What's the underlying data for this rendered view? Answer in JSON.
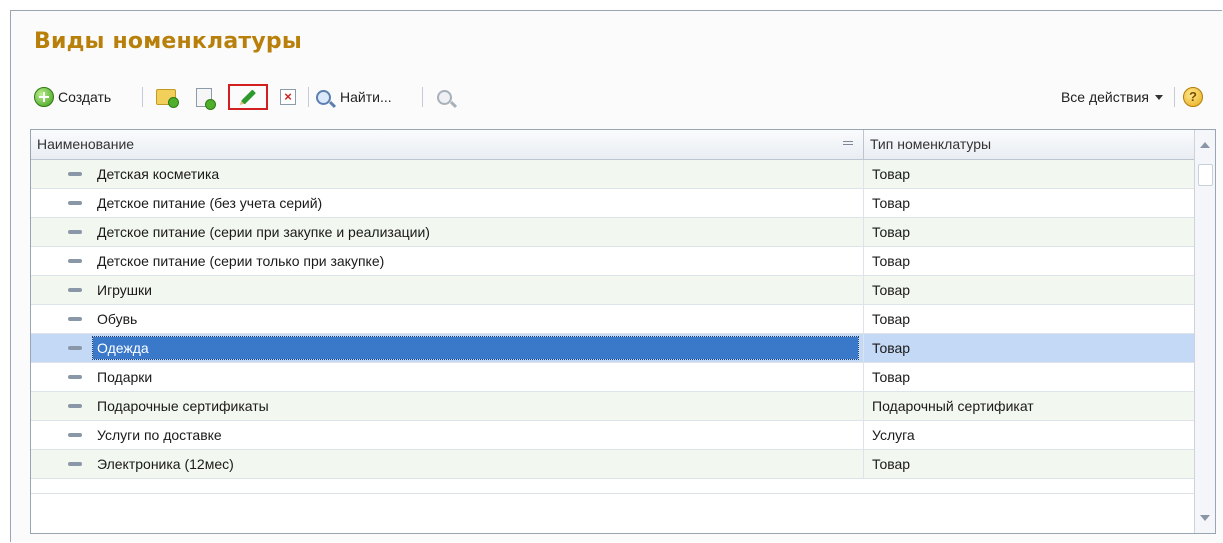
{
  "form": {
    "title": "Виды номенклатуры"
  },
  "toolbar": {
    "create_label": "Создать",
    "find_label": "Найти...",
    "all_actions_label": "Все действия",
    "help_label": "?"
  },
  "table": {
    "columns": [
      "Наименование",
      "Тип номенклатуры"
    ],
    "rows": [
      {
        "name": "Детская косметика",
        "type": "Товар"
      },
      {
        "name": "Детское питание (без учета серий)",
        "type": "Товар"
      },
      {
        "name": "Детское питание (серии при закупке и реализации)",
        "type": "Товар"
      },
      {
        "name": "Детское питание (серии только при закупке)",
        "type": "Товар"
      },
      {
        "name": "Игрушки",
        "type": "Товар"
      },
      {
        "name": "Обувь",
        "type": "Товар"
      },
      {
        "name": "Одежда",
        "type": "Товар"
      },
      {
        "name": "Подарки",
        "type": "Товар"
      },
      {
        "name": "Подарочные сертификаты",
        "type": "Подарочный сертификат"
      },
      {
        "name": "Услуги по доставке",
        "type": "Услуга"
      },
      {
        "name": "Электроника (12мес)",
        "type": "Товар"
      }
    ],
    "selected_row": "Одежда"
  },
  "colors": {
    "title": "#b8800a",
    "selection": "#3a78c9",
    "highlight_border": "#d21f1f"
  }
}
